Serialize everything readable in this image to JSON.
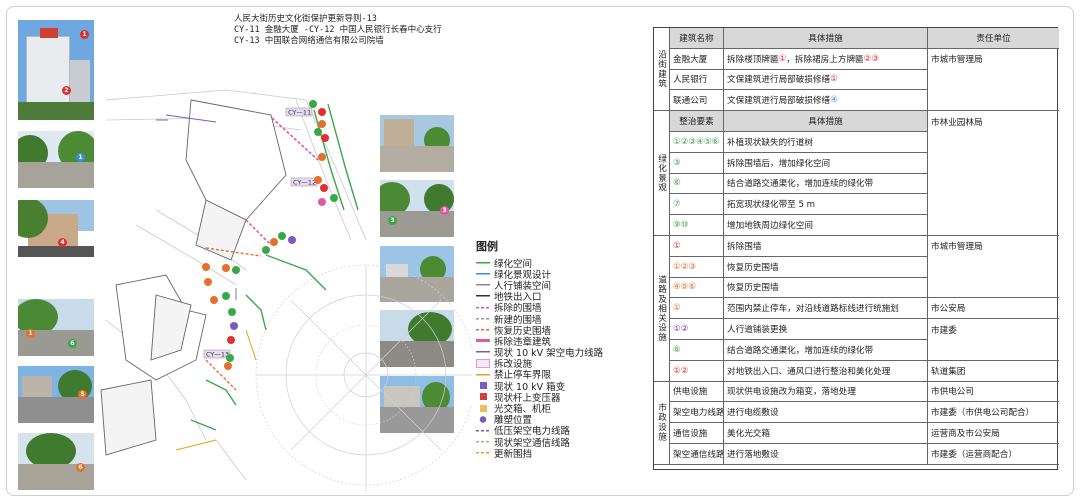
{
  "title_lines": [
    "人民大街历史文化街保护更新导则-13",
    "CY-11 金融大厦 -CY-12 中国人民银行长春中心支行",
    "CY-13 中国联合网络通信有限公司院墙"
  ],
  "map_labels": [
    "CY—11",
    "CY—12",
    "CY—13"
  ],
  "photo_markers": [
    "1",
    "2",
    "1",
    "4",
    "1",
    "6",
    "5",
    "6",
    "3",
    "3"
  ],
  "legend": {
    "title": "图例",
    "items": [
      {
        "label": "绿化空间",
        "color": "#3aa84a",
        "style": "line"
      },
      {
        "label": "绿化景观设计",
        "color": "#3a8fd8",
        "style": "line"
      },
      {
        "label": "人行铺装空间",
        "color": "#8a8a8a",
        "style": "line"
      },
      {
        "label": "地铁出入口",
        "color": "#333333",
        "style": "line"
      },
      {
        "label": "拆除的围墙",
        "color": "#e05aa0",
        "style": "dash"
      },
      {
        "label": "新建的围墙",
        "color": "#9a9a9a",
        "style": "dash"
      },
      {
        "label": "恢复历史围墙",
        "color": "#e5702e",
        "style": "dash"
      },
      {
        "label": "拆除违章建筑",
        "color": "#e05aa0",
        "style": "thick"
      },
      {
        "label": "现状 10 kV 架空电力线路",
        "color": "#7a5bc0",
        "style": "line"
      },
      {
        "label": "拆改设施",
        "color": "#d0a0d0",
        "style": "box"
      },
      {
        "label": "禁止停车界限",
        "color": "#e8a020",
        "style": "line"
      },
      {
        "label": "现状 10 kV 箱变",
        "color": "#7a5bc0",
        "style": "square"
      },
      {
        "label": "现状杆上变压器",
        "color": "#d04040",
        "style": "square"
      },
      {
        "label": "光交箱、机柜",
        "color": "#e8c060",
        "style": "square"
      },
      {
        "label": "雕塑位置",
        "color": "#7a5bc0",
        "style": "dot"
      },
      {
        "label": "低压架空电力线路",
        "color": "#7a5bc0",
        "style": "dash"
      },
      {
        "label": "现状架空通信线路",
        "color": "#c0a080",
        "style": "dash"
      },
      {
        "label": "更新围挡",
        "color": "#e8a020",
        "style": "dash"
      }
    ]
  },
  "table": {
    "sections": [
      {
        "name": "沿街建筑",
        "header": [
          "建筑名称",
          "具体措施",
          "责任单位"
        ],
        "rows": [
          {
            "item": "金融大厦",
            "measure": "拆除楼顶牌匾",
            "marks": [
              {
                "t": "①",
                "c": "r"
              }
            ],
            "measure2": "，拆除裙房上方牌匾",
            "marks2": [
              {
                "t": "②③",
                "c": "r"
              }
            ],
            "unit": "市城市管理局"
          },
          {
            "item": "人民银行",
            "measure": "文保建筑进行局部破损修缮",
            "marks": [
              {
                "t": " ①",
                "c": "r"
              }
            ],
            "unit": ""
          },
          {
            "item": "联通公司",
            "measure": "文保建筑进行局部破损修缮",
            "marks": [
              {
                "t": " ④",
                "c": "b"
              }
            ],
            "unit": ""
          }
        ]
      },
      {
        "name": "绿化景观",
        "header": [
          "整治要素",
          "具体措施",
          "市林业园林局"
        ],
        "rows": [
          {
            "item": "①②③④⑤⑥",
            "ic": "g",
            "measure": "补植现状缺失的行道树"
          },
          {
            "item": "③",
            "ic": "g",
            "measure": "拆除围墙后，增加绿化空间"
          },
          {
            "item": "⑥",
            "ic": "g",
            "measure": "结合道路交通渠化，增加连续的绿化带"
          },
          {
            "item": "⑦",
            "ic": "g",
            "measure": "拓宽现状绿化带至 5 m"
          },
          {
            "item": "⑨⑩",
            "ic": "g",
            "measure": "增加地铁周边绿化空间"
          }
        ]
      },
      {
        "name": "道路及相关设施",
        "rows": [
          {
            "item": "①",
            "ic": "r",
            "measure": "拆除围墙",
            "unit": "市城市管理局"
          },
          {
            "item": "①②③",
            "ic": "o",
            "measure": "恢复历史围墙",
            "unit": ""
          },
          {
            "item": "④⑤⑥",
            "ic": "o",
            "measure": "恢复历史围墙",
            "unit": ""
          },
          {
            "item": "①",
            "ic": "o",
            "measure": "范围内禁止停车，对沿线道路标线进行统施划",
            "unit": "市公安局"
          },
          {
            "item": "①②",
            "ic": "p",
            "measure": "人行道铺装更换",
            "unit": "市建委"
          },
          {
            "item": "⑥",
            "ic": "g",
            "measure": "结合道路交通渠化，增加连续的绿化带",
            "unit": ""
          },
          {
            "item": "①②",
            "ic": "r",
            "measure": "对地铁出入口、通风口进行整治和美化处理",
            "unit": "轨道集团"
          }
        ]
      },
      {
        "name": "市政设施",
        "rows": [
          {
            "item": "供电设施",
            "measure": "现状供电设施改为箱变，落地处理",
            "unit": "市供电公司"
          },
          {
            "item": "架空电力线路",
            "measure": "进行电缆敷设",
            "unit": "市建委（市供电公司配合）"
          },
          {
            "item": "通信设施",
            "measure": "美化光交箱",
            "unit": "运营商及市公安局"
          },
          {
            "item": "架空通信线路",
            "measure": "进行落地敷设",
            "unit": "市建委（运营商配合）"
          }
        ]
      }
    ]
  }
}
